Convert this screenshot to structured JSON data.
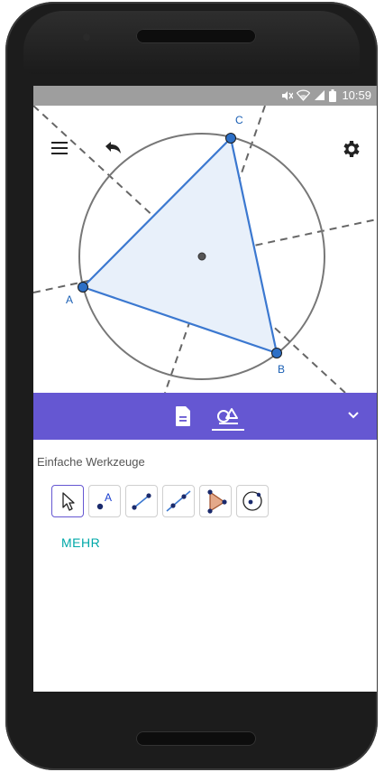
{
  "statusbar": {
    "time": "10:59",
    "icons": [
      "mute-icon",
      "wifi-icon",
      "signal-icon",
      "battery-icon"
    ]
  },
  "app": {
    "icons": [
      "menu-icon",
      "undo-icon",
      "settings-icon"
    ]
  },
  "construction": {
    "points": [
      {
        "label": "A"
      },
      {
        "label": "B"
      },
      {
        "label": "C"
      }
    ],
    "colors": {
      "triangle": "#3b78d0",
      "fill": "#e8f0fa",
      "circle": "#777777",
      "lines": "#666666",
      "point": "#2d6fc6"
    }
  },
  "toolbar": {
    "color": "#6557d2",
    "tabs": [
      {
        "icon": "document-icon",
        "active": false
      },
      {
        "icon": "tools-icon",
        "active": true
      }
    ],
    "collapse_icon": "chevron-down-icon"
  },
  "tools_panel": {
    "section_title": "Einfache Werkzeuge",
    "tools": [
      {
        "name": "move-tool",
        "icon": "arrow-cursor-icon",
        "selected": true
      },
      {
        "name": "point-tool",
        "icon": "point-icon",
        "label": "A",
        "selected": false
      },
      {
        "name": "segment-tool",
        "icon": "segment-icon",
        "selected": false
      },
      {
        "name": "line-tool",
        "icon": "line-icon",
        "selected": false
      },
      {
        "name": "polygon-tool",
        "icon": "polygon-icon",
        "selected": false
      },
      {
        "name": "circle-tool",
        "icon": "circle-icon",
        "selected": false
      }
    ],
    "more_label": "MEHR",
    "more_color": "#00a8a8"
  }
}
